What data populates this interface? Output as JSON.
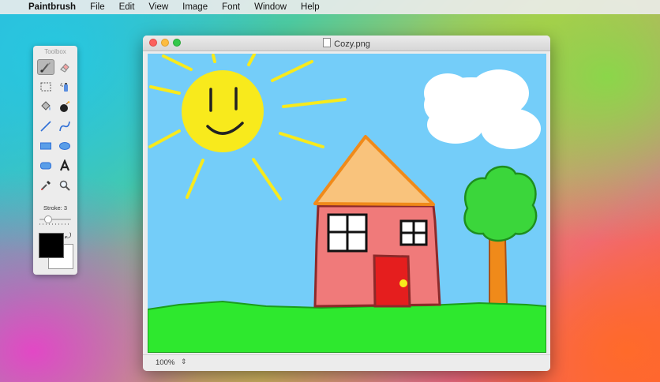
{
  "menubar": {
    "app_name": "Paintbrush",
    "items": [
      "File",
      "Edit",
      "View",
      "Image",
      "Font",
      "Window",
      "Help"
    ]
  },
  "toolbox": {
    "title": "Toolbox",
    "stroke_label": "Stroke: 3",
    "stroke_value": 3,
    "foreground_color": "#000000",
    "background_color": "#ffffff",
    "tools": [
      "brush",
      "eraser",
      "select",
      "spray",
      "fill",
      "bomb",
      "line",
      "curve",
      "rectangle",
      "ellipse",
      "rounded-rectangle",
      "text",
      "eyedropper",
      "zoom"
    ],
    "selected_tool": "brush"
  },
  "window": {
    "title": "Cozy.png",
    "zoom": "100%"
  },
  "colors": {
    "sky": "#74cdf9",
    "sun": "#f8ea1c",
    "grass": "#2ee82e",
    "house": "#f07a7a",
    "roof": "#f9c37c",
    "door": "#e51e1e",
    "tree": "#3bd63b",
    "trunk": "#f08a1a"
  }
}
